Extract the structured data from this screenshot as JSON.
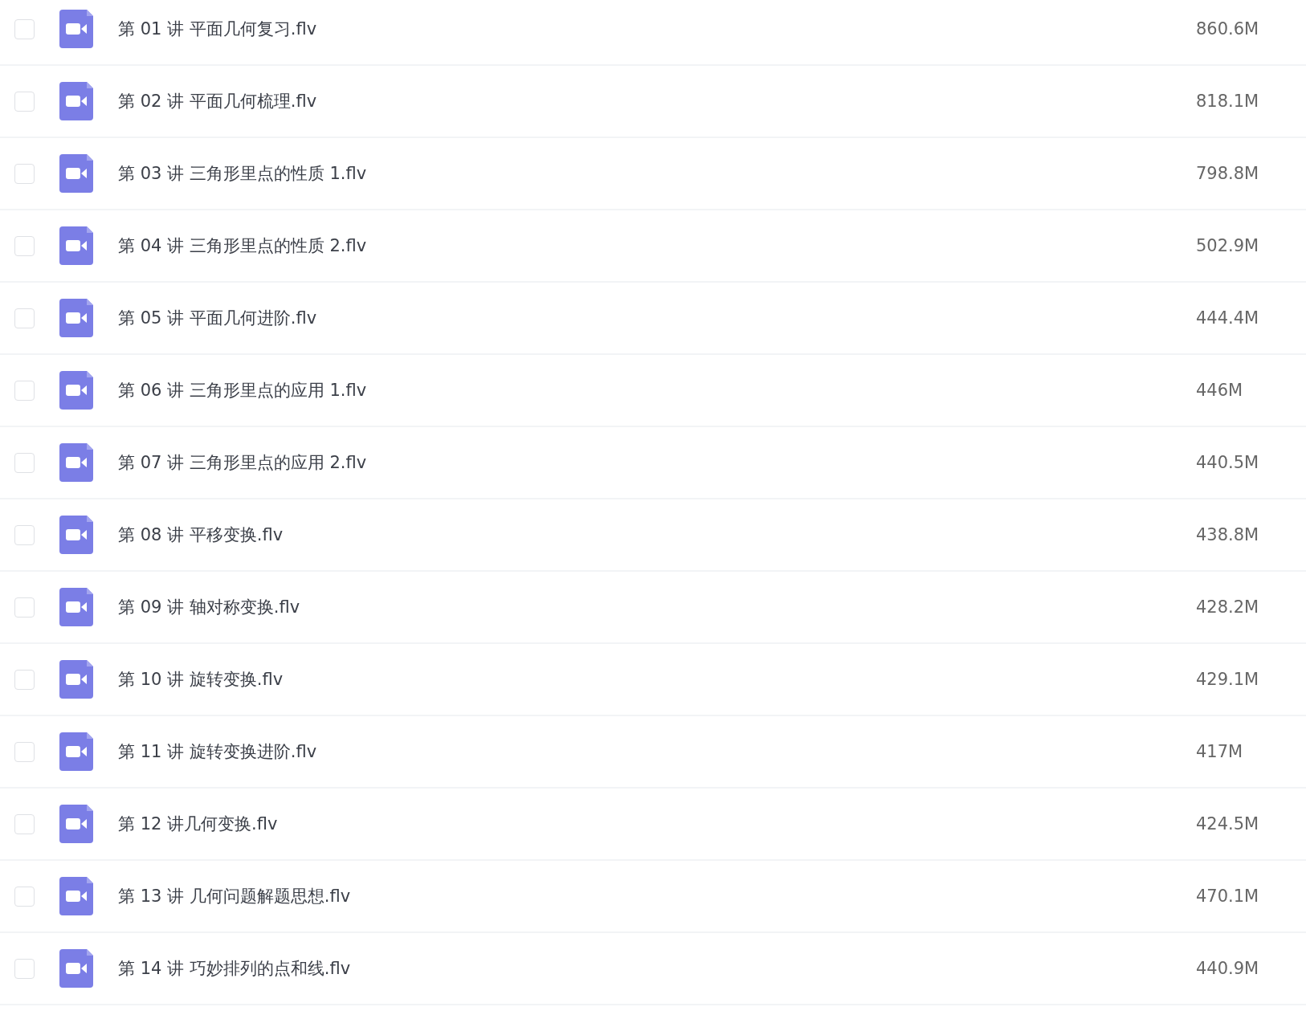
{
  "files": [
    {
      "name": "第 01 讲 平面几何复习.flv",
      "size": "860.6M",
      "checked": false
    },
    {
      "name": "第 02 讲 平面几何梳理.flv",
      "size": "818.1M",
      "checked": false
    },
    {
      "name": "第 03 讲 三角形里点的性质 1.flv",
      "size": "798.8M",
      "checked": false
    },
    {
      "name": "第 04 讲 三角形里点的性质 2.flv",
      "size": "502.9M",
      "checked": false
    },
    {
      "name": "第 05 讲 平面几何进阶.flv",
      "size": "444.4M",
      "checked": false
    },
    {
      "name": "第 06 讲 三角形里点的应用 1.flv",
      "size": "446M",
      "checked": false
    },
    {
      "name": "第 07 讲 三角形里点的应用 2.flv",
      "size": "440.5M",
      "checked": false
    },
    {
      "name": "第 08 讲 平移变换.flv",
      "size": "438.8M",
      "checked": false
    },
    {
      "name": "第 09 讲 轴对称变换.flv",
      "size": "428.2M",
      "checked": false
    },
    {
      "name": "第 10 讲 旋转变换.flv",
      "size": "429.1M",
      "checked": false
    },
    {
      "name": "第 11 讲 旋转变换进阶.flv",
      "size": "417M",
      "checked": false
    },
    {
      "name": "第 12 讲几何变换.flv",
      "size": "424.5M",
      "checked": false
    },
    {
      "name": "第 13 讲 几何问题解题思想.flv",
      "size": "470.1M",
      "checked": false
    },
    {
      "name": "第 14 讲 巧妙排列的点和线.flv",
      "size": "440.9M",
      "checked": false
    }
  ]
}
